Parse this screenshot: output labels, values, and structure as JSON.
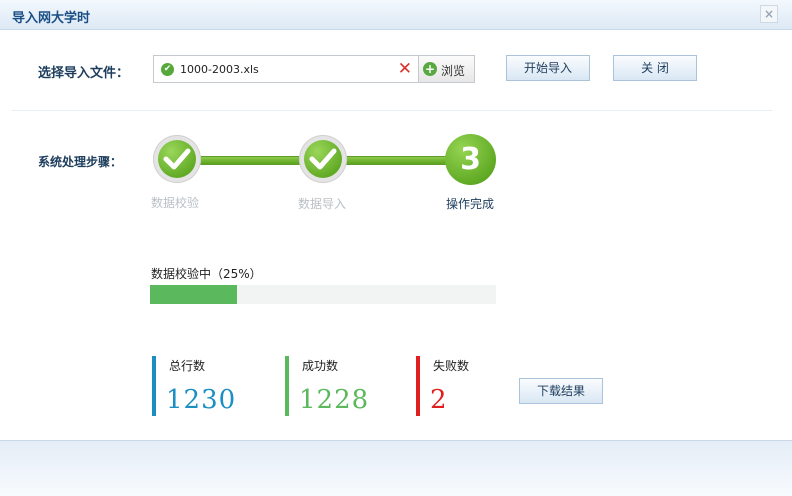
{
  "window": {
    "title": "导入网大学时",
    "close_glyph": "×"
  },
  "file_section": {
    "label": "选择导入文件：",
    "file_name": "1000-2003.xls",
    "remove_glyph": "✕",
    "browse_label": "浏览"
  },
  "buttons": {
    "start_import": "开始导入",
    "close": "关 闭",
    "download_results": "下载结果"
  },
  "steps": {
    "label": "系统处理步骤：",
    "items": [
      {
        "label": "数据校验",
        "state": "done"
      },
      {
        "label": "数据导入",
        "state": "done"
      },
      {
        "label": "操作完成",
        "state": "current",
        "number": "3"
      }
    ]
  },
  "progress": {
    "label": "数据校验中（25%）",
    "percent": 25,
    "color": "#5cb85c"
  },
  "stats": [
    {
      "label": "总行数",
      "value": "1230",
      "color": "#1b8fc2"
    },
    {
      "label": "成功数",
      "value": "1228",
      "color": "#5cb85c"
    },
    {
      "label": "失败数",
      "value": "2",
      "color": "#e02020"
    }
  ],
  "icons": {
    "file_status": "check-circle-icon",
    "remove": "close-icon",
    "browse": "plus-circle-icon",
    "step_done": "check-icon"
  }
}
